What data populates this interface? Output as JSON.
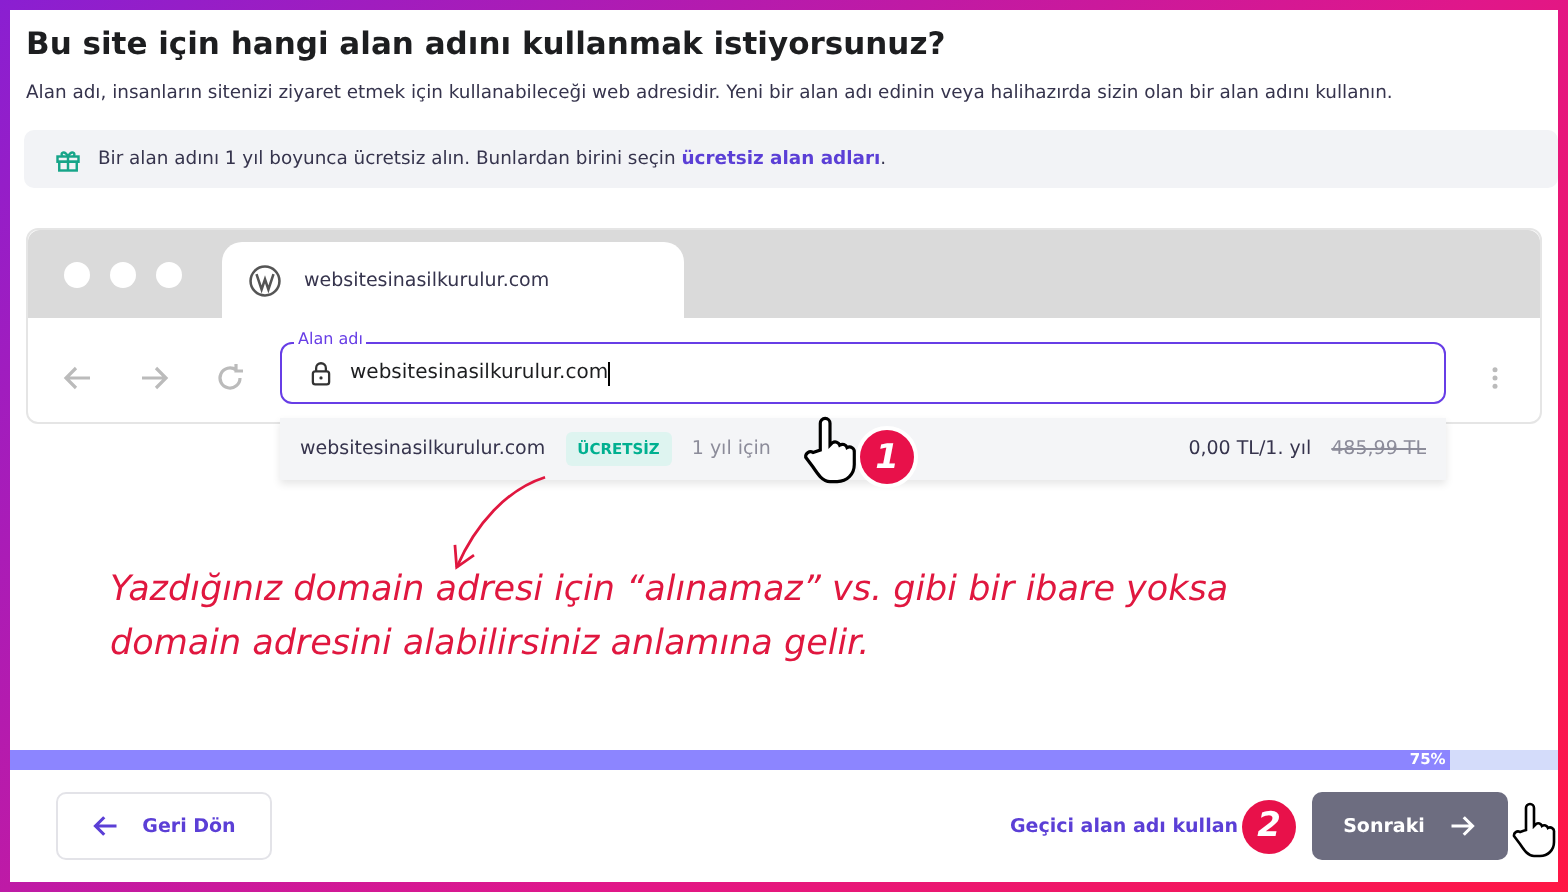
{
  "title": "Bu site için hangi alan adını kullanmak istiyorsunuz?",
  "description": "Alan adı, insanların sitenizi ziyaret etmek için kullanabileceği web adresidir. Yeni bir alan adı edinin veya halihazırda sizin olan bir alan adını kullanın.",
  "info": {
    "text": "Bir alan adını 1 yıl boyunca ücretsiz alın. Bunlardan birini seçin ",
    "link": "ücretsiz alan adları",
    "suffix": "."
  },
  "browser": {
    "tab_title": "websitesinasilkurulur.com",
    "field_label": "Alan adı",
    "field_value": "websitesinasilkurulur.com"
  },
  "suggestions": [
    {
      "domain": "websitesinasilkurulur.com",
      "badge": "ÜCRETSİZ",
      "term": "1 yıl için",
      "price": "0,00 TL/1. yıl",
      "old_price": "485,99 TL"
    }
  ],
  "annotation": {
    "text": "Yazdığınız domain adresi için “alınamaz” vs. gibi bir ibare yoksa domain adresini alabilirsiniz anlamına gelir.",
    "step_badges": [
      "1",
      "2"
    ]
  },
  "progress": {
    "level": 0.93,
    "label": "75%"
  },
  "footer": {
    "back": "Geri Dön",
    "temp_link": "Geçici alan adı kullan",
    "next": "Sonraki"
  }
}
